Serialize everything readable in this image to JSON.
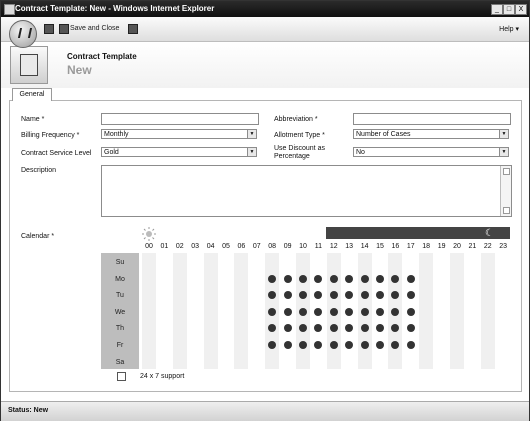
{
  "window": {
    "title": "Contract Template: New - Windows Internet Explorer",
    "controls": [
      "_",
      "□",
      "X"
    ]
  },
  "toolbar": {
    "save_icon": "floppy-disk-icon",
    "save_and_close_label": "Save and Close",
    "help_label": "Help ▾"
  },
  "header": {
    "title": "Contract Template",
    "subtitle": "New"
  },
  "tabs": [
    {
      "label": "General"
    }
  ],
  "form": {
    "name_label": "Name *",
    "name_value": "",
    "abbreviation_label": "Abbreviation *",
    "abbreviation_value": "",
    "billing_frequency_label": "Billing Frequency *",
    "billing_frequency_value": "Monthly",
    "allotment_type_label": "Allotment Type *",
    "allotment_type_value": "Number of Cases",
    "service_level_label": "Contract Service Level",
    "service_level_value": "Gold",
    "use_discount_label_1": "Use Discount as",
    "use_discount_label_2": "Percentage",
    "use_discount_value": "No",
    "description_label": "Description",
    "description_value": ""
  },
  "calendar": {
    "label": "Calendar *",
    "hours": [
      "00",
      "01",
      "02",
      "03",
      "04",
      "05",
      "06",
      "07",
      "08",
      "09",
      "10",
      "11",
      "12",
      "13",
      "14",
      "15",
      "16",
      "17",
      "18",
      "19",
      "20",
      "21",
      "22",
      "23"
    ],
    "days": [
      "Su",
      "Mo",
      "Tu",
      "We",
      "Th",
      "Fr",
      "Sa"
    ],
    "active_days": [
      1,
      2,
      3,
      4,
      5
    ],
    "active_hours": [
      8,
      9,
      10,
      11,
      12,
      13,
      14,
      15,
      16,
      17
    ],
    "support_24x7_label": "24 x 7 support",
    "support_24x7_checked": false
  },
  "status": {
    "text": "Status: New"
  }
}
